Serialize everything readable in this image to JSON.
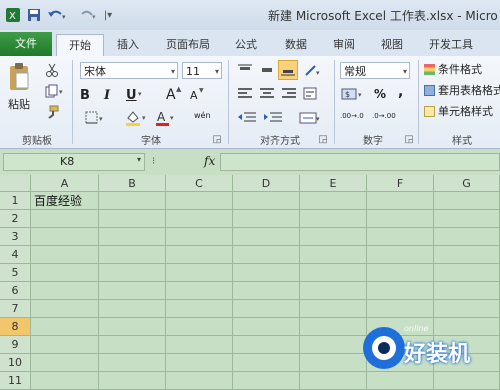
{
  "title": "新建 Microsoft Excel 工作表.xlsx - Micro",
  "tabs": [
    "文件",
    "开始",
    "插入",
    "页面布局",
    "公式",
    "数据",
    "审阅",
    "视图",
    "开发工具"
  ],
  "clipboard": {
    "paste_label": "粘贴",
    "group_label": "剪贴板"
  },
  "font": {
    "name": "宋体",
    "size": "11",
    "bold": "B",
    "italic": "I",
    "underline": "U",
    "grow": "A",
    "shrink": "A",
    "group_label": "字体",
    "phonetic": "wén"
  },
  "alignment": {
    "group_label": "对齐方式"
  },
  "number": {
    "format": "常规",
    "percent": "%",
    "comma": ",",
    "group_label": "数字",
    "dec_inc": ".00→.0",
    "dec_dec": ".0→.00"
  },
  "styles": {
    "conditional": "条件格式",
    "table_format": "套用表格格式",
    "cell_styles": "单元格样式",
    "group_label": "样式"
  },
  "formula_bar": {
    "name_box": "K8",
    "fx": "fx"
  },
  "grid": {
    "columns": [
      "A",
      "B",
      "C",
      "D",
      "E",
      "F",
      "G"
    ],
    "rows": [
      "1",
      "2",
      "3",
      "4",
      "5",
      "6",
      "7",
      "8",
      "9",
      "10",
      "11"
    ],
    "active_row": "8",
    "a1": "百度经验"
  },
  "watermark": {
    "brand": "好装机",
    "sub": "online"
  }
}
